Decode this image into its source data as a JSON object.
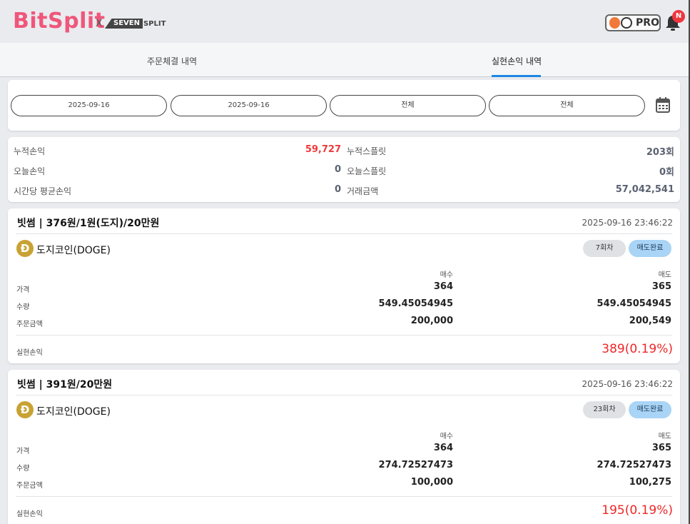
{
  "header": {
    "logo": "BitSplit",
    "x": "X",
    "partner_box": "SEVEN",
    "partner_tail": "SPLIT",
    "pro_label": "PRO",
    "notification_badge": "N"
  },
  "tabs": [
    {
      "label": "주문체결 내역",
      "active": false
    },
    {
      "label": "실현손익 내역",
      "active": true
    }
  ],
  "filters": {
    "start_date": "2025-09-16",
    "end_date": "2025-09-16",
    "filter1": "전체",
    "filter2": "전체"
  },
  "summary": {
    "cum_pnl_label": "누적손익",
    "cum_pnl_value": "59,727",
    "cum_split_label": "누적스플릿",
    "cum_split_value": "203회",
    "today_pnl_label": "오늘손익",
    "today_pnl_value": "0",
    "today_split_label": "오늘스플릿",
    "today_split_value": "0회",
    "hourly_pnl_label": "시간당 평균손익",
    "hourly_pnl_value": "0",
    "volume_label": "거래금액",
    "volume_value": "57,042,541"
  },
  "labels": {
    "buy": "매수",
    "sell": "매도",
    "price": "가격",
    "qty": "수량",
    "amount": "주문금액",
    "pnl": "실현손익"
  },
  "trades": [
    {
      "title": "빗썸 | 376원/1원(도지)/20만원",
      "datetime": "2025-09-16 23:46:22",
      "coin_symbol": "Đ",
      "coin": "도지코인(DOGE)",
      "round": "7회차",
      "status": "매도완료",
      "buy_price": "364",
      "sell_price": "365",
      "buy_qty": "549.45054945",
      "sell_qty": "549.45054945",
      "buy_amount": "200,000",
      "sell_amount": "200,549",
      "pnl": "389(0.19%)"
    },
    {
      "title": "빗썸 | 391원/20만원",
      "datetime": "2025-09-16 23:46:22",
      "coin_symbol": "Đ",
      "coin": "도지코인(DOGE)",
      "round": "23회차",
      "status": "매도완료",
      "buy_price": "364",
      "sell_price": "365",
      "buy_qty": "274.72527473",
      "sell_qty": "274.72527473",
      "buy_amount": "100,000",
      "sell_amount": "100,275",
      "pnl": "195(0.19%)"
    }
  ],
  "colors": {
    "brand": "#f0567a",
    "accent": "#1e88e5",
    "profit": "#f02626",
    "status_pill": "#a9d4f5"
  }
}
